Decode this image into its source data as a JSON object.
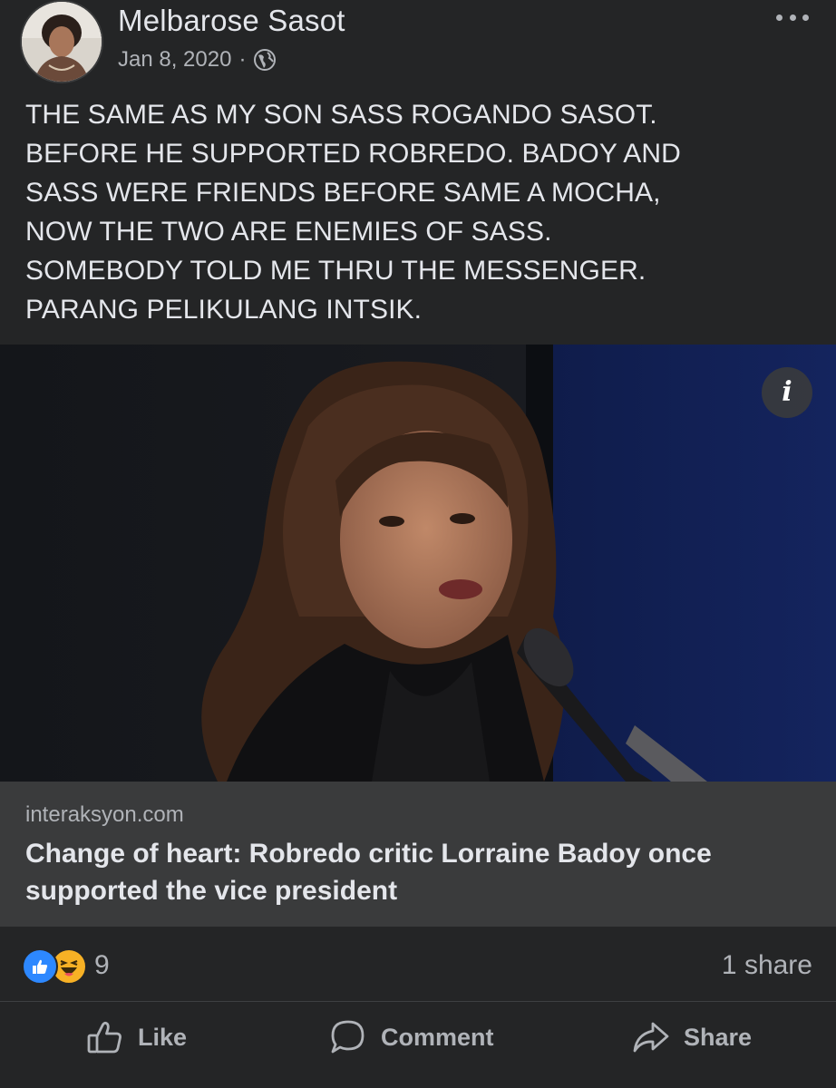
{
  "post": {
    "author": "Melbarose Sasot",
    "date": "Jan 8, 2020",
    "separator": "·",
    "privacy_icon": "globe-icon",
    "text": "THE SAME AS MY SON SASS ROGANDO SASOT.\nBEFORE HE SUPPORTED ROBREDO.  BADOY AND\nSASS WERE FRIENDS BEFORE SAME A MOCHA,\nNOW THE TWO ARE ENEMIES OF SASS.\nSOMEBODY TOLD ME THRU THE MESSENGER.\nPARANG PELIKULANG INTSIK."
  },
  "link": {
    "domain": "interaksyon.com",
    "title": "Change of heart: Robredo critic Lorraine Badoy once supported the vice president",
    "info_icon": "info-icon",
    "info_label": "i"
  },
  "engagement": {
    "reaction_icons": [
      "like-reaction-icon",
      "haha-reaction-icon"
    ],
    "reaction_count": "9",
    "share_count": "1 share"
  },
  "actions": {
    "like_label": "Like",
    "comment_label": "Comment",
    "share_label": "Share"
  },
  "colors": {
    "background": "#242526",
    "card": "#3a3b3c",
    "text_primary": "#e4e6eb",
    "text_secondary": "#b0b3b8",
    "like_blue": "#2d88ff",
    "haha_yellow": "#f7b125"
  }
}
